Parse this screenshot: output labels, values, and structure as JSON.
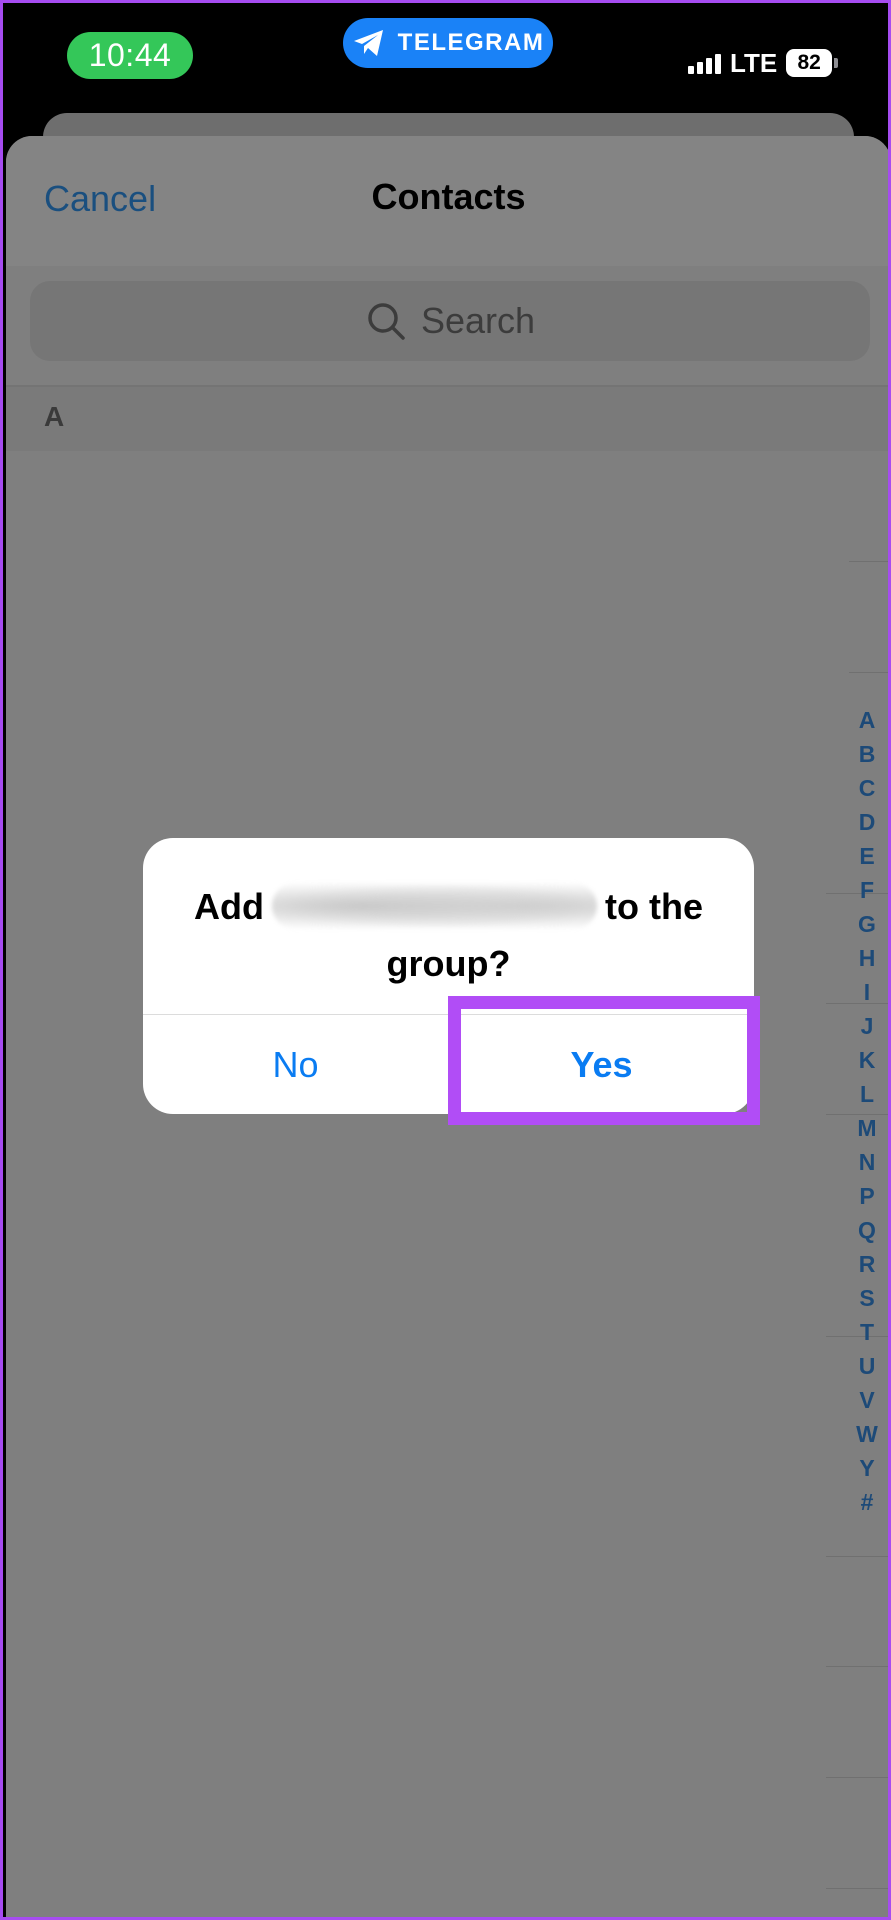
{
  "status_bar": {
    "time": "10:44",
    "app_pill_label": "TELEGRAM",
    "app_pill_icon": "telegram-plane-icon",
    "network_label": "LTE",
    "battery_level": "82",
    "colors": {
      "time_pill": "#34c759",
      "app_pill": "#1a82f7"
    }
  },
  "nav": {
    "cancel_label": "Cancel",
    "title": "Contacts"
  },
  "search": {
    "icon": "search-icon",
    "placeholder": "Search"
  },
  "list": {
    "section_letter": "A"
  },
  "alpha_index": [
    "A",
    "B",
    "C",
    "D",
    "E",
    "F",
    "G",
    "H",
    "I",
    "J",
    "K",
    "L",
    "M",
    "N",
    "P",
    "Q",
    "R",
    "S",
    "T",
    "U",
    "V",
    "W",
    "Y",
    "#"
  ],
  "alert": {
    "message_prefix": "Add",
    "message_suffix": "to the",
    "message_line2": "group?",
    "no_label": "No",
    "yes_label": "Yes",
    "button_color": "#0a7cf2"
  },
  "highlight": {
    "color": "#b14df6"
  }
}
